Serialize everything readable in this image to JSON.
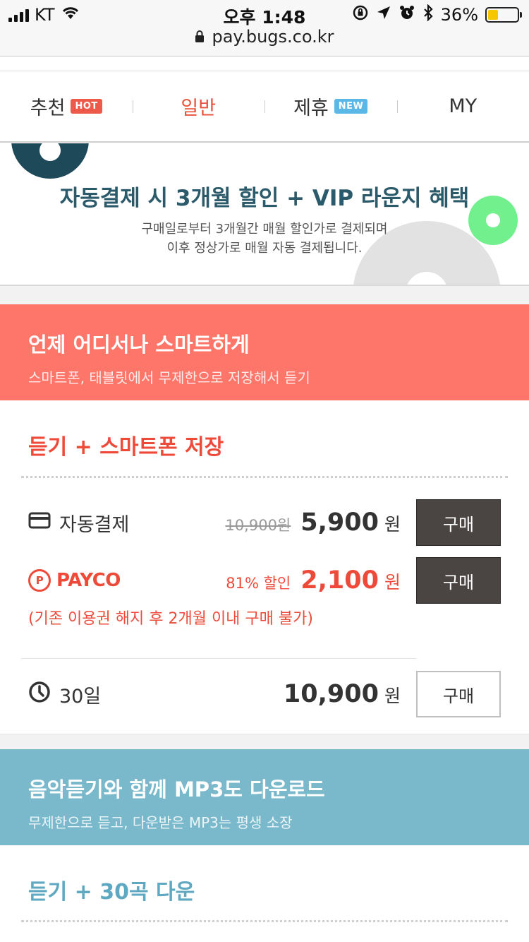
{
  "status_bar": {
    "carrier": "KT",
    "time": "오후 1:48",
    "battery_percent": "36%",
    "battery_level": 0.36
  },
  "url": "pay.bugs.co.kr",
  "tabs": [
    {
      "label": "추천",
      "badge": "HOT"
    },
    {
      "label": "일반",
      "active": true
    },
    {
      "label": "제휴",
      "badge": "NEW"
    },
    {
      "label": "MY"
    }
  ],
  "banner": {
    "title": "자동결제 시 3개월 할인 + VIP 라운지 혜택",
    "sub_line1": "구매일로부터 3개월간 매월 할인가로 결제되며",
    "sub_line2": "이후 정상가로 매월 자동 결제됩니다."
  },
  "section1": {
    "heading": "언제 어디서나 스마트하게",
    "subheading": "스마트폰, 태블릿에서 무제한으로 저장해서 듣기",
    "card_title": "듣기 + 스마트폰 저장",
    "auto_pay": {
      "label": "자동결제",
      "original_price": "10,900원",
      "price": "5,900",
      "unit": "원",
      "button": "구매"
    },
    "payco": {
      "label": "PAYCO",
      "badge": "P",
      "discount": "81% 할인",
      "price": "2,100",
      "unit": "원",
      "button": "구매",
      "notice": "(기존 이용권 해지 후 2개월 이내 구매 불가)"
    },
    "days30": {
      "label": "30일",
      "price": "10,900",
      "unit": "원",
      "button": "구매"
    }
  },
  "section2": {
    "heading": "음악듣기와 함께 MP3도 다운로드",
    "subheading": "무제한으로 듣고, 다운받은 MP3는 평생 소장",
    "card_title": "듣기 + 30곡 다운"
  },
  "colors": {
    "accent_red": "#ee4a3a",
    "coral": "#fe766a",
    "blue": "#7ab8cc",
    "dark_button": "#4a4443"
  }
}
